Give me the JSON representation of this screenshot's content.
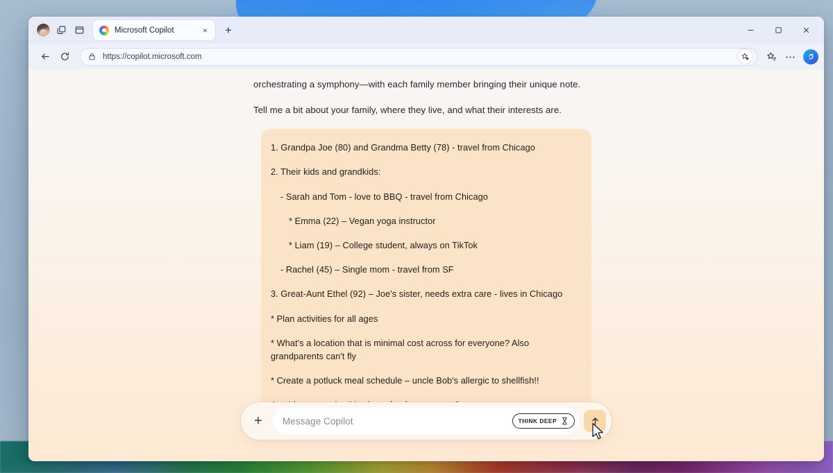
{
  "browser": {
    "profile_label": "profile-avatar",
    "workspaces_label": "workspaces",
    "tab_actions_label": "tab actions",
    "tab": {
      "title": "Microsoft Copilot",
      "close_label": "×"
    },
    "new_tab_label": "+",
    "window_controls": {
      "minimize": "─",
      "maximize": "□",
      "close": "✕"
    },
    "nav": {
      "back_label": "←",
      "reload_label": "↻",
      "url": "https://copilot.microsoft.com",
      "more_label": "⋯"
    }
  },
  "conversation": {
    "assistant_paragraphs": [
      "orchestrating a symphony—with each family member bringing their unique note.",
      "Tell me a bit about your family, where they live, and what their interests are."
    ],
    "user_bubble": {
      "lines": [
        {
          "text": "1. Grandpa Joe (80) and Grandma Betty (78) - travel from Chicago",
          "indent": 0,
          "tight": false
        },
        {
          "text": "2. Their kids and grandkids:",
          "indent": 0,
          "tight": false
        },
        {
          "text": "- Sarah and Tom - love to BBQ - travel from Chicago",
          "indent": 1,
          "tight": false
        },
        {
          "text": "* Emma (22) – Vegan yoga instructor",
          "indent": 2,
          "tight": false
        },
        {
          "text": "* Liam (19) – College student, always on TikTok",
          "indent": 2,
          "tight": false
        },
        {
          "text": "- Rachel (45) – Single mom - travel from SF",
          "indent": 1,
          "tight": true
        },
        {
          "text": "3. Great-Aunt Ethel (92) – Joe's sister, needs extra care - lives in Chicago",
          "indent": 0,
          "tight": false
        },
        {
          "text": "* Plan activities for all ages",
          "indent": 0,
          "tight": false
        },
        {
          "text": "* What's a location that is minimal cost across for everyone? Also grandparents can't fly",
          "indent": 0,
          "tight": false
        },
        {
          "text": "* Create a potluck meal schedule – uncle Bob's allergic to shellfish!!",
          "indent": 0,
          "tight": false
        },
        {
          "text": "Any ideas to make this chaos fun for everyone?",
          "indent": 0,
          "tight": false
        }
      ]
    }
  },
  "composer": {
    "add_label": "+",
    "placeholder": "Message Copilot",
    "think_deep_label": "THINK DEEP",
    "send_label": "↑"
  },
  "colors": {
    "bubble_bg": "#fbe3c8",
    "send_btn_bg": "#fbd8ab",
    "page_gradient_top": "#f8f5f3",
    "page_gradient_bottom": "#fde9d3"
  }
}
